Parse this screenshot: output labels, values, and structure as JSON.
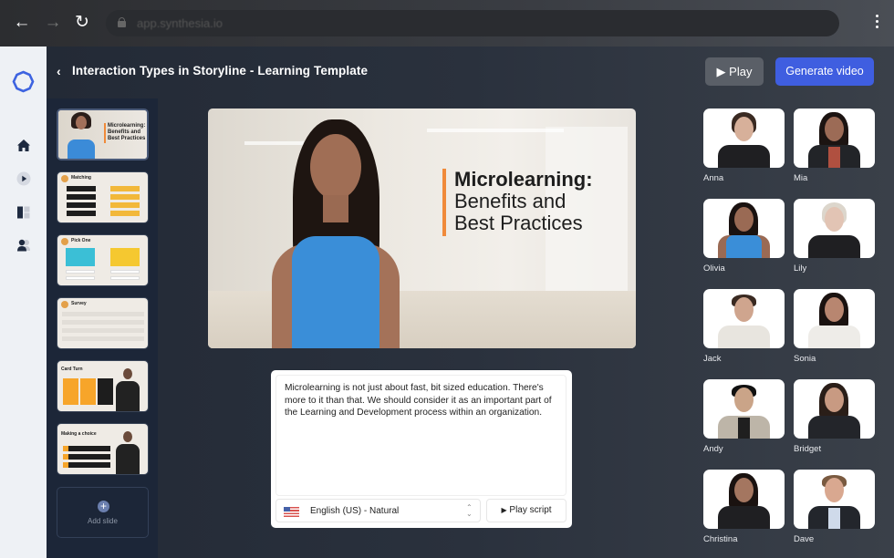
{
  "browser": {
    "url": "app.synthesia.io",
    "back_icon": "arrow-left",
    "forward_icon": "arrow-right",
    "reload_icon": "reload",
    "menu_icon": "kebab-vertical"
  },
  "leftnav": {
    "logo": "synthesia-logo",
    "items": [
      {
        "icon": "home-icon",
        "label": "Home"
      },
      {
        "icon": "play-circle-icon",
        "label": "Videos"
      },
      {
        "icon": "templates-icon",
        "label": "Templates"
      },
      {
        "icon": "avatars-icon",
        "label": "Avatars"
      }
    ]
  },
  "header": {
    "back_label": "<",
    "title": "Interaction Types in Storyline - Learning Template",
    "play_label": "Play",
    "generate_label": "Generate video",
    "colors": {
      "primary": "#3f5ee0",
      "secondary": "#5a5f67"
    }
  },
  "slides": [
    {
      "title": "Microlearning: Benefits and Best Practices",
      "selected": true
    },
    {
      "title": "Matching"
    },
    {
      "title": "Pick One"
    },
    {
      "title": "Survey"
    },
    {
      "title": "Card Turn"
    },
    {
      "title": "Making a choice"
    }
  ],
  "add_slide_label": "Add slide",
  "canvas": {
    "title_line1": "Microlearning:",
    "title_line2": "Benefits and",
    "title_line3": "Best Practices",
    "accent": "#f08a3a"
  },
  "script": {
    "text": "Microlearning is not just about fast, bit sized education. There's more to it than that. We should consider it as an important part of the Learning and Development process within an organization.",
    "language": "English (US) - Natural",
    "play_script_label": "Play script"
  },
  "avatars": [
    {
      "name": "Anna"
    },
    {
      "name": "Mia"
    },
    {
      "name": "Olivia"
    },
    {
      "name": "Lily"
    },
    {
      "name": "Jack"
    },
    {
      "name": "Sonia"
    },
    {
      "name": "Andy"
    },
    {
      "name": "Bridget"
    },
    {
      "name": "Christina"
    },
    {
      "name": "Dave"
    }
  ]
}
